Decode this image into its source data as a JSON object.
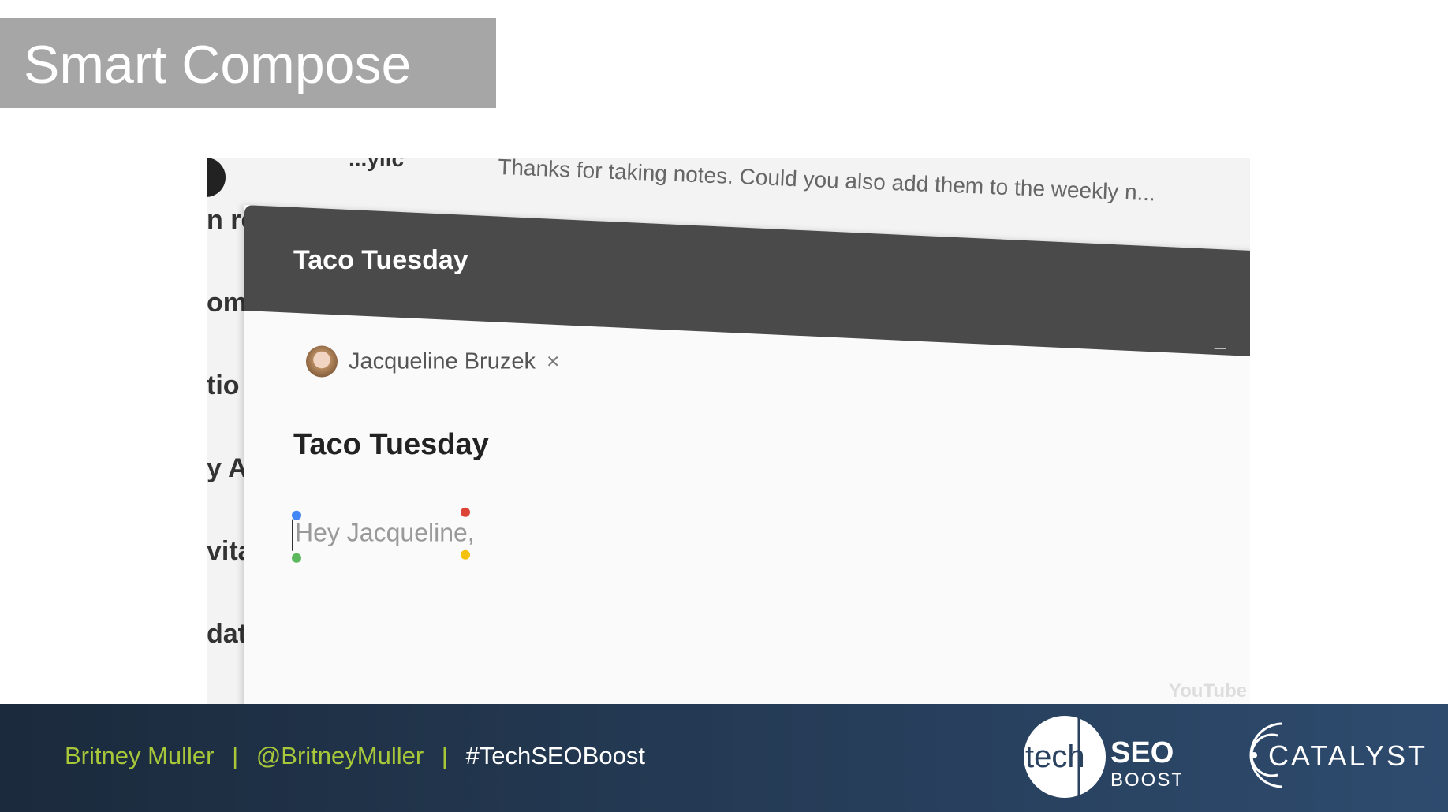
{
  "slide": {
    "title": "Smart Compose"
  },
  "background_inbox": {
    "sender_fragment": "...ylic",
    "preview": "Thanks for taking notes. Could you also add them to the weekly n...",
    "side_fragments": [
      "n re",
      "om",
      "tio",
      "y Al",
      "vita",
      "dat"
    ]
  },
  "compose": {
    "window_title": "Taco Tuesday",
    "minimize_icon": "minimize-icon",
    "expand_icon": "fullscreen-icon",
    "recipient": "Jacqueline Bruzek",
    "remove_icon": "×",
    "subject": "Taco Tuesday",
    "body_text": "Hey Jacqueline,",
    "dot_colors": [
      "#4285f4",
      "#db4437",
      "#0f9d58",
      "#f4b400"
    ]
  },
  "watermark": "YouTube",
  "footer": {
    "name": "Britney Muller",
    "sep": "|",
    "handle": "@BritneyMuller",
    "hashtag": "#TechSEOBoost",
    "logo_tech": "techSEO BOOST",
    "logo_catalyst": "CATALYST",
    "accent": "#a8c83a"
  }
}
